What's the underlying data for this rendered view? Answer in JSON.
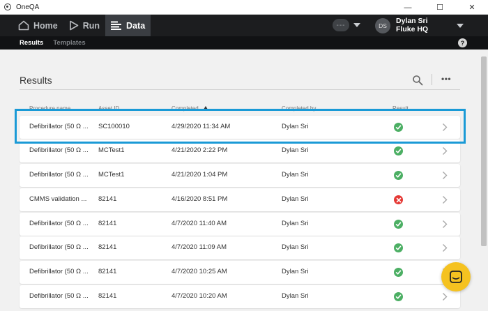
{
  "window": {
    "title": "OneQA",
    "controls": [
      "—",
      "☐",
      "✕"
    ]
  },
  "nav": {
    "items": [
      {
        "label": "Home",
        "icon": "home-icon"
      },
      {
        "label": "Run",
        "icon": "play-icon"
      },
      {
        "label": "Data",
        "icon": "data-list-icon",
        "active": true
      }
    ],
    "status_pill": "---",
    "avatar_initials": "DS",
    "user_name": "Dylan Sri",
    "user_org": "Fluke HQ"
  },
  "subnav": {
    "tabs": [
      {
        "label": "Results",
        "active": true
      },
      {
        "label": "Templates",
        "active": false
      }
    ],
    "help": "?"
  },
  "results": {
    "title": "Results",
    "more": "•••",
    "columns": {
      "procedure": "Procedure name",
      "asset": "Asset ID",
      "completed": "Completed",
      "completed_by": "Completed by",
      "result": "Result"
    },
    "rows": [
      {
        "procedure": "Defibrillator (50 Ω ...",
        "asset": "SC100010",
        "completed": "4/29/2020 11:34 AM",
        "by": "Dylan Sri",
        "result": "pass"
      },
      {
        "procedure": "Defibrillator (50 Ω ...",
        "asset": "MCTest1",
        "completed": "4/21/2020 2:22 PM",
        "by": "Dylan Sri",
        "result": "pass"
      },
      {
        "procedure": "Defibrillator (50 Ω ...",
        "asset": "MCTest1",
        "completed": "4/21/2020 1:04 PM",
        "by": "Dylan Sri",
        "result": "pass"
      },
      {
        "procedure": "CMMS validation ...",
        "asset": "82141",
        "completed": "4/16/2020 8:51 PM",
        "by": "Dylan Sri",
        "result": "fail"
      },
      {
        "procedure": "Defibrillator (50 Ω ...",
        "asset": "82141",
        "completed": "4/7/2020 11:40 AM",
        "by": "Dylan Sri",
        "result": "pass"
      },
      {
        "procedure": "Defibrillator (50 Ω ...",
        "asset": "82141",
        "completed": "4/7/2020 11:09 AM",
        "by": "Dylan Sri",
        "result": "pass"
      },
      {
        "procedure": "Defibrillator (50 Ω ...",
        "asset": "82141",
        "completed": "4/7/2020 10:25 AM",
        "by": "Dylan Sri",
        "result": "pass"
      },
      {
        "procedure": "Defibrillator (50 Ω ...",
        "asset": "82141",
        "completed": "4/7/2020 10:20 AM",
        "by": "Dylan Sri",
        "result": "pass"
      }
    ]
  },
  "colors": {
    "nav_bg": "#1c1d1f",
    "pass": "#4caf64",
    "fail": "#e53935",
    "highlight": "#1a9ad6",
    "chat": "#f5c220"
  }
}
